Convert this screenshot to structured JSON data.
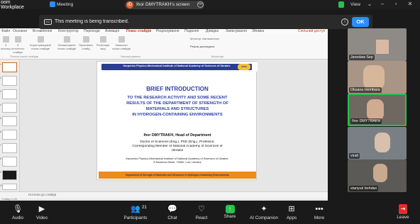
{
  "app": {
    "title": "oom Workplace",
    "meeting_title": "Meeting"
  },
  "screen_share": {
    "owner_initial": "ID",
    "label": "Ihor DMYTRAKH's screen"
  },
  "topbar": {
    "view_label": "View"
  },
  "banner": {
    "text": "This meeting is being transcribed.",
    "ok_label": "OK"
  },
  "ppt": {
    "tabs": [
      "Файл",
      "Основне",
      "Вставлення",
      "Конструктор",
      "Переходи",
      "Анімація",
      "Показ слайдів",
      "Рецензування",
      "Подання",
      "Довідка",
      "Записування",
      "Зйомка",
      "Спільний доступ"
    ],
    "ribbon_buttons": [
      "З початку",
      "З поточного слайда",
      "Користувацький показ слайдів",
      "Налаштувати показ слайдів",
      "Приховати слайд",
      "Репетиція часу",
      "Записати показ слайдів"
    ],
    "groups": [
      "Почати показ слайдів",
      "Налаштування",
      "Монітори"
    ],
    "monitor_label": "Монітор: Автоматично",
    "presenter_label": "Режим доповідача",
    "notes_placeholder": "Нотатки до слайда",
    "status_text": "Слайд 1 з 25",
    "thumb_numbers": [
      "1",
      "2",
      "3",
      "4",
      "5",
      "6",
      "7",
      "8",
      "9",
      "10"
    ]
  },
  "slide": {
    "header": "Karpenko Physico-Mechanical Institute of National Academy of Sciences of Ukraine",
    "logo": "KPMI",
    "title": "BRIEF INTRODUCTION",
    "subtitle_lines": [
      "TO THE RESEARCH ACTIVITY AND SOME RECENT",
      "RESULTS OF THE DEPARTMENT OF STRENGTH OF",
      "MATERIALS AND STRUCTURES",
      "IN HYDROGEN-CONTAINING ENVIRONMENTS"
    ],
    "author": "Ihor DMYTRAKH, Head of Department",
    "degree_lines": [
      "Doctor of Sciences (Eng.), PhD (Eng.), Professor,",
      "Corresponding Member of National Academy of Sciences of",
      "Ukraine"
    ],
    "institute_lines": [
      "Karpenko Physico-Mechanical Institute of National Academy of Sciences of Ukraine,",
      "5 Naukova Street, 79060, Lviv, Ukraine"
    ],
    "footer": "Department of Strength of Materials and Structures in Hydrogen-Containing Environments"
  },
  "participants": [
    {
      "name": "Jaroslaw Sep"
    },
    {
      "name": "Oksana Hembara"
    },
    {
      "name": "Ihor DMYTRAKH"
    },
    {
      "name": "virah"
    },
    {
      "name": "stanyuk bohdan"
    }
  ],
  "toolbar": {
    "audio": "Audio",
    "video": "Video",
    "participants": "Participants",
    "participants_count": "21",
    "chat": "Chat",
    "react": "React",
    "share": "Share",
    "ai_companion": "AI Companion",
    "apps": "Apps",
    "more": "More",
    "leave": "Leave"
  },
  "colors": {
    "accent": "#2d8cff",
    "share": "#27c24c",
    "leave": "#e02d2d",
    "slide_title": "#2b3da8",
    "slide_footer": "#f08a1a"
  }
}
